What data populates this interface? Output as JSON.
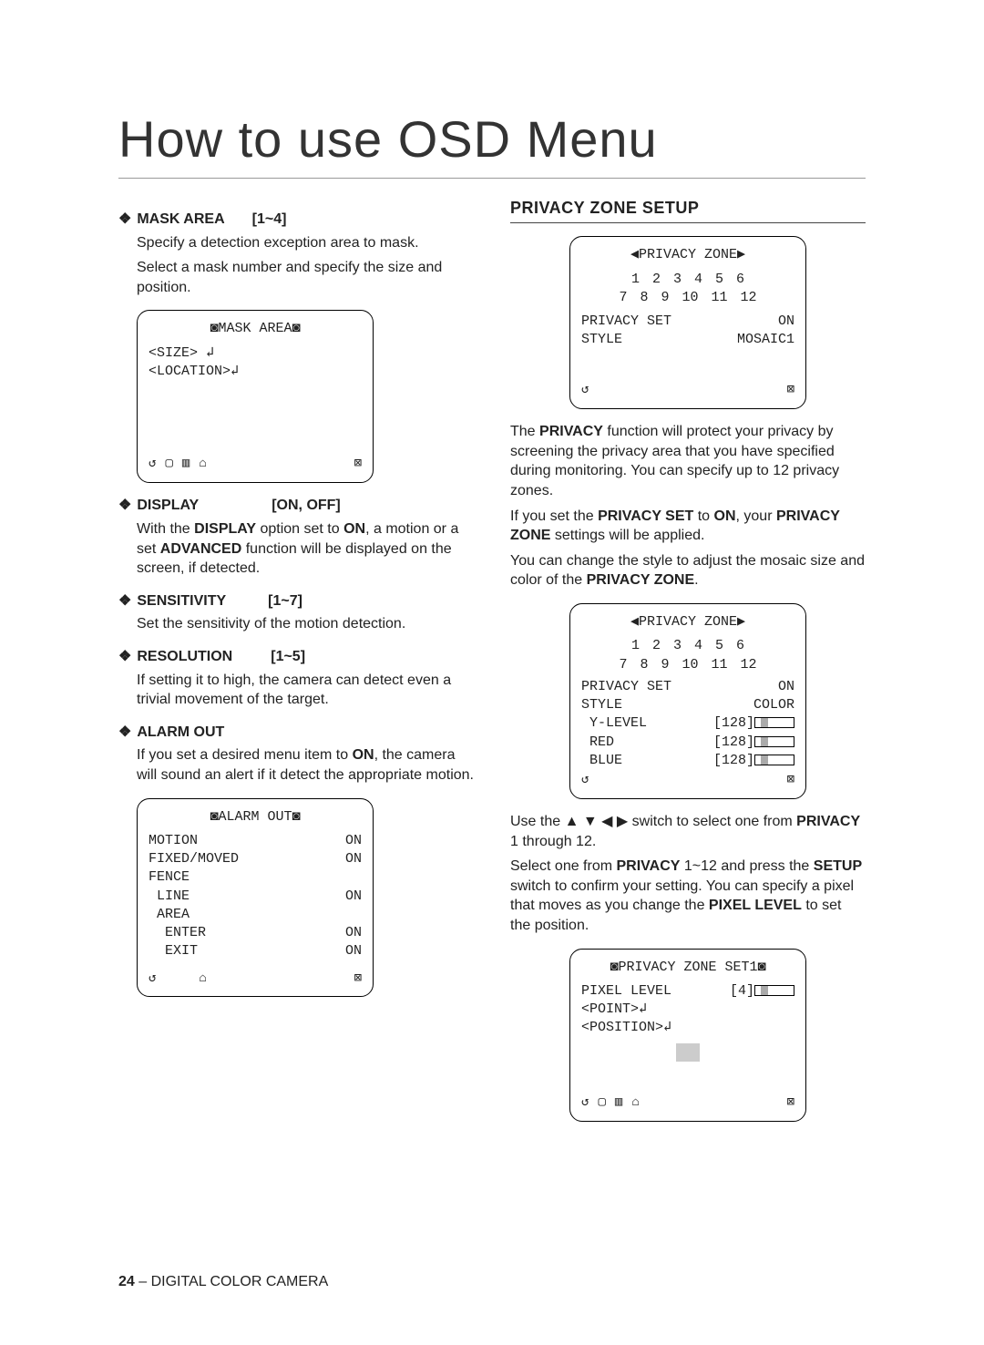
{
  "page_title": "How to use OSD Menu",
  "footer_page": "24",
  "footer_text": " – DIGITAL COLOR CAMERA",
  "left": {
    "mask_area": {
      "name": "MASK AREA",
      "range": "[1~4]",
      "desc1": "Specify a detection exception area to mask.",
      "desc2": "Select a mask number and specify the size and position."
    },
    "mask_osd": {
      "title": "◙MASK AREA◙",
      "line1": "<SIZE> ↲",
      "line2": "<LOCATION>↲"
    },
    "display": {
      "name": "DISPLAY",
      "range": "[ON, OFF]",
      "desc_pre": "With the ",
      "desc_b1": "DISPLAY",
      "desc_mid1": " option set to ",
      "desc_b2": "ON",
      "desc_mid2": ", a motion or a set ",
      "desc_b3": "ADVANCED",
      "desc_post": " function will be displayed on the screen, if detected."
    },
    "sensitivity": {
      "name": "SENSITIVITY",
      "range": "[1~7]",
      "desc": "Set the sensitivity of the motion detection."
    },
    "resolution": {
      "name": "RESOLUTION",
      "range": "[1~5]",
      "desc": "If setting it to high, the camera can detect even a trivial movement of the target."
    },
    "alarm_out": {
      "name": "ALARM OUT",
      "desc_pre": "If you set a desired menu item to ",
      "desc_b1": "ON",
      "desc_post": ", the camera will sound an alert if it detect the appropriate motion."
    },
    "alarm_osd": {
      "title": "◙ALARM OUT◙",
      "rows": [
        {
          "l": "MOTION",
          "r": "ON"
        },
        {
          "l": "FIXED/MOVED",
          "r": "ON"
        },
        {
          "l": "FENCE",
          "r": ""
        },
        {
          "l": " LINE",
          "r": "ON"
        },
        {
          "l": " AREA",
          "r": ""
        },
        {
          "l": "  ENTER",
          "r": "ON"
        },
        {
          "l": "  EXIT",
          "r": "ON"
        }
      ]
    }
  },
  "right": {
    "section_title": "PRIVACY ZONE SETUP",
    "osd1": {
      "title": "◀PRIVACY ZONE▶",
      "row1": [
        "1",
        "2",
        "3",
        "4",
        "5",
        "6"
      ],
      "row2": [
        "7",
        "8",
        "9",
        "10",
        "11",
        "12"
      ],
      "privacy_set_l": "PRIVACY SET",
      "privacy_set_r": "ON",
      "style_l": "STYLE",
      "style_r": "MOSAIC1"
    },
    "para1_pre": "The ",
    "para1_b1": "PRIVACY",
    "para1_post": " function will protect your privacy by screening the privacy area that you have specified during monitoring. You can specify up to 12 privacy zones.",
    "para2_pre": "If you set the ",
    "para2_b1": "PRIVACY SET",
    "para2_mid1": " to ",
    "para2_b2": "ON",
    "para2_mid2": ", your ",
    "para2_b3": "PRIVACY ZONE",
    "para2_post": " settings will be applied.",
    "para3_pre": "You can change the style to adjust the mosaic size and color of the ",
    "para3_b1": "PRIVACY ZONE",
    "para3_post": ".",
    "osd2": {
      "title": "◀PRIVACY ZONE▶",
      "privacy_set_l": "PRIVACY SET",
      "privacy_set_r": "ON",
      "style_l": "STYLE",
      "style_r": "COLOR",
      "ylevel_l": " Y-LEVEL",
      "ylevel_r": "[128]",
      "red_l": " RED",
      "red_r": "[128]",
      "blue_l": " BLUE",
      "blue_r": "[128]"
    },
    "para4_pre": "Use the ▲ ▼ ◀ ▶ switch to select one from ",
    "para4_b1": "PRIVACY",
    "para4_post": " 1 through 12.",
    "para5_pre": "Select one from ",
    "para5_b1": "PRIVACY",
    "para5_mid1": " 1~12 and press the ",
    "para5_b2": "SETUP",
    "para5_mid2": " switch to confirm your setting. You can specify a pixel that moves as you change the ",
    "para5_b3": "PIXEL LEVEL",
    "para5_post": " to set the position.",
    "osd3": {
      "title": "◙PRIVACY ZONE SET1◙",
      "pixel_l": "PIXEL LEVEL",
      "pixel_r": "[4]",
      "point": "<POINT>↲",
      "position": "<POSITION>↲"
    }
  },
  "nav": {
    "back": "↺",
    "i1": "▢",
    "i2": "▥",
    "i3": "⌂",
    "close": "⊠"
  }
}
